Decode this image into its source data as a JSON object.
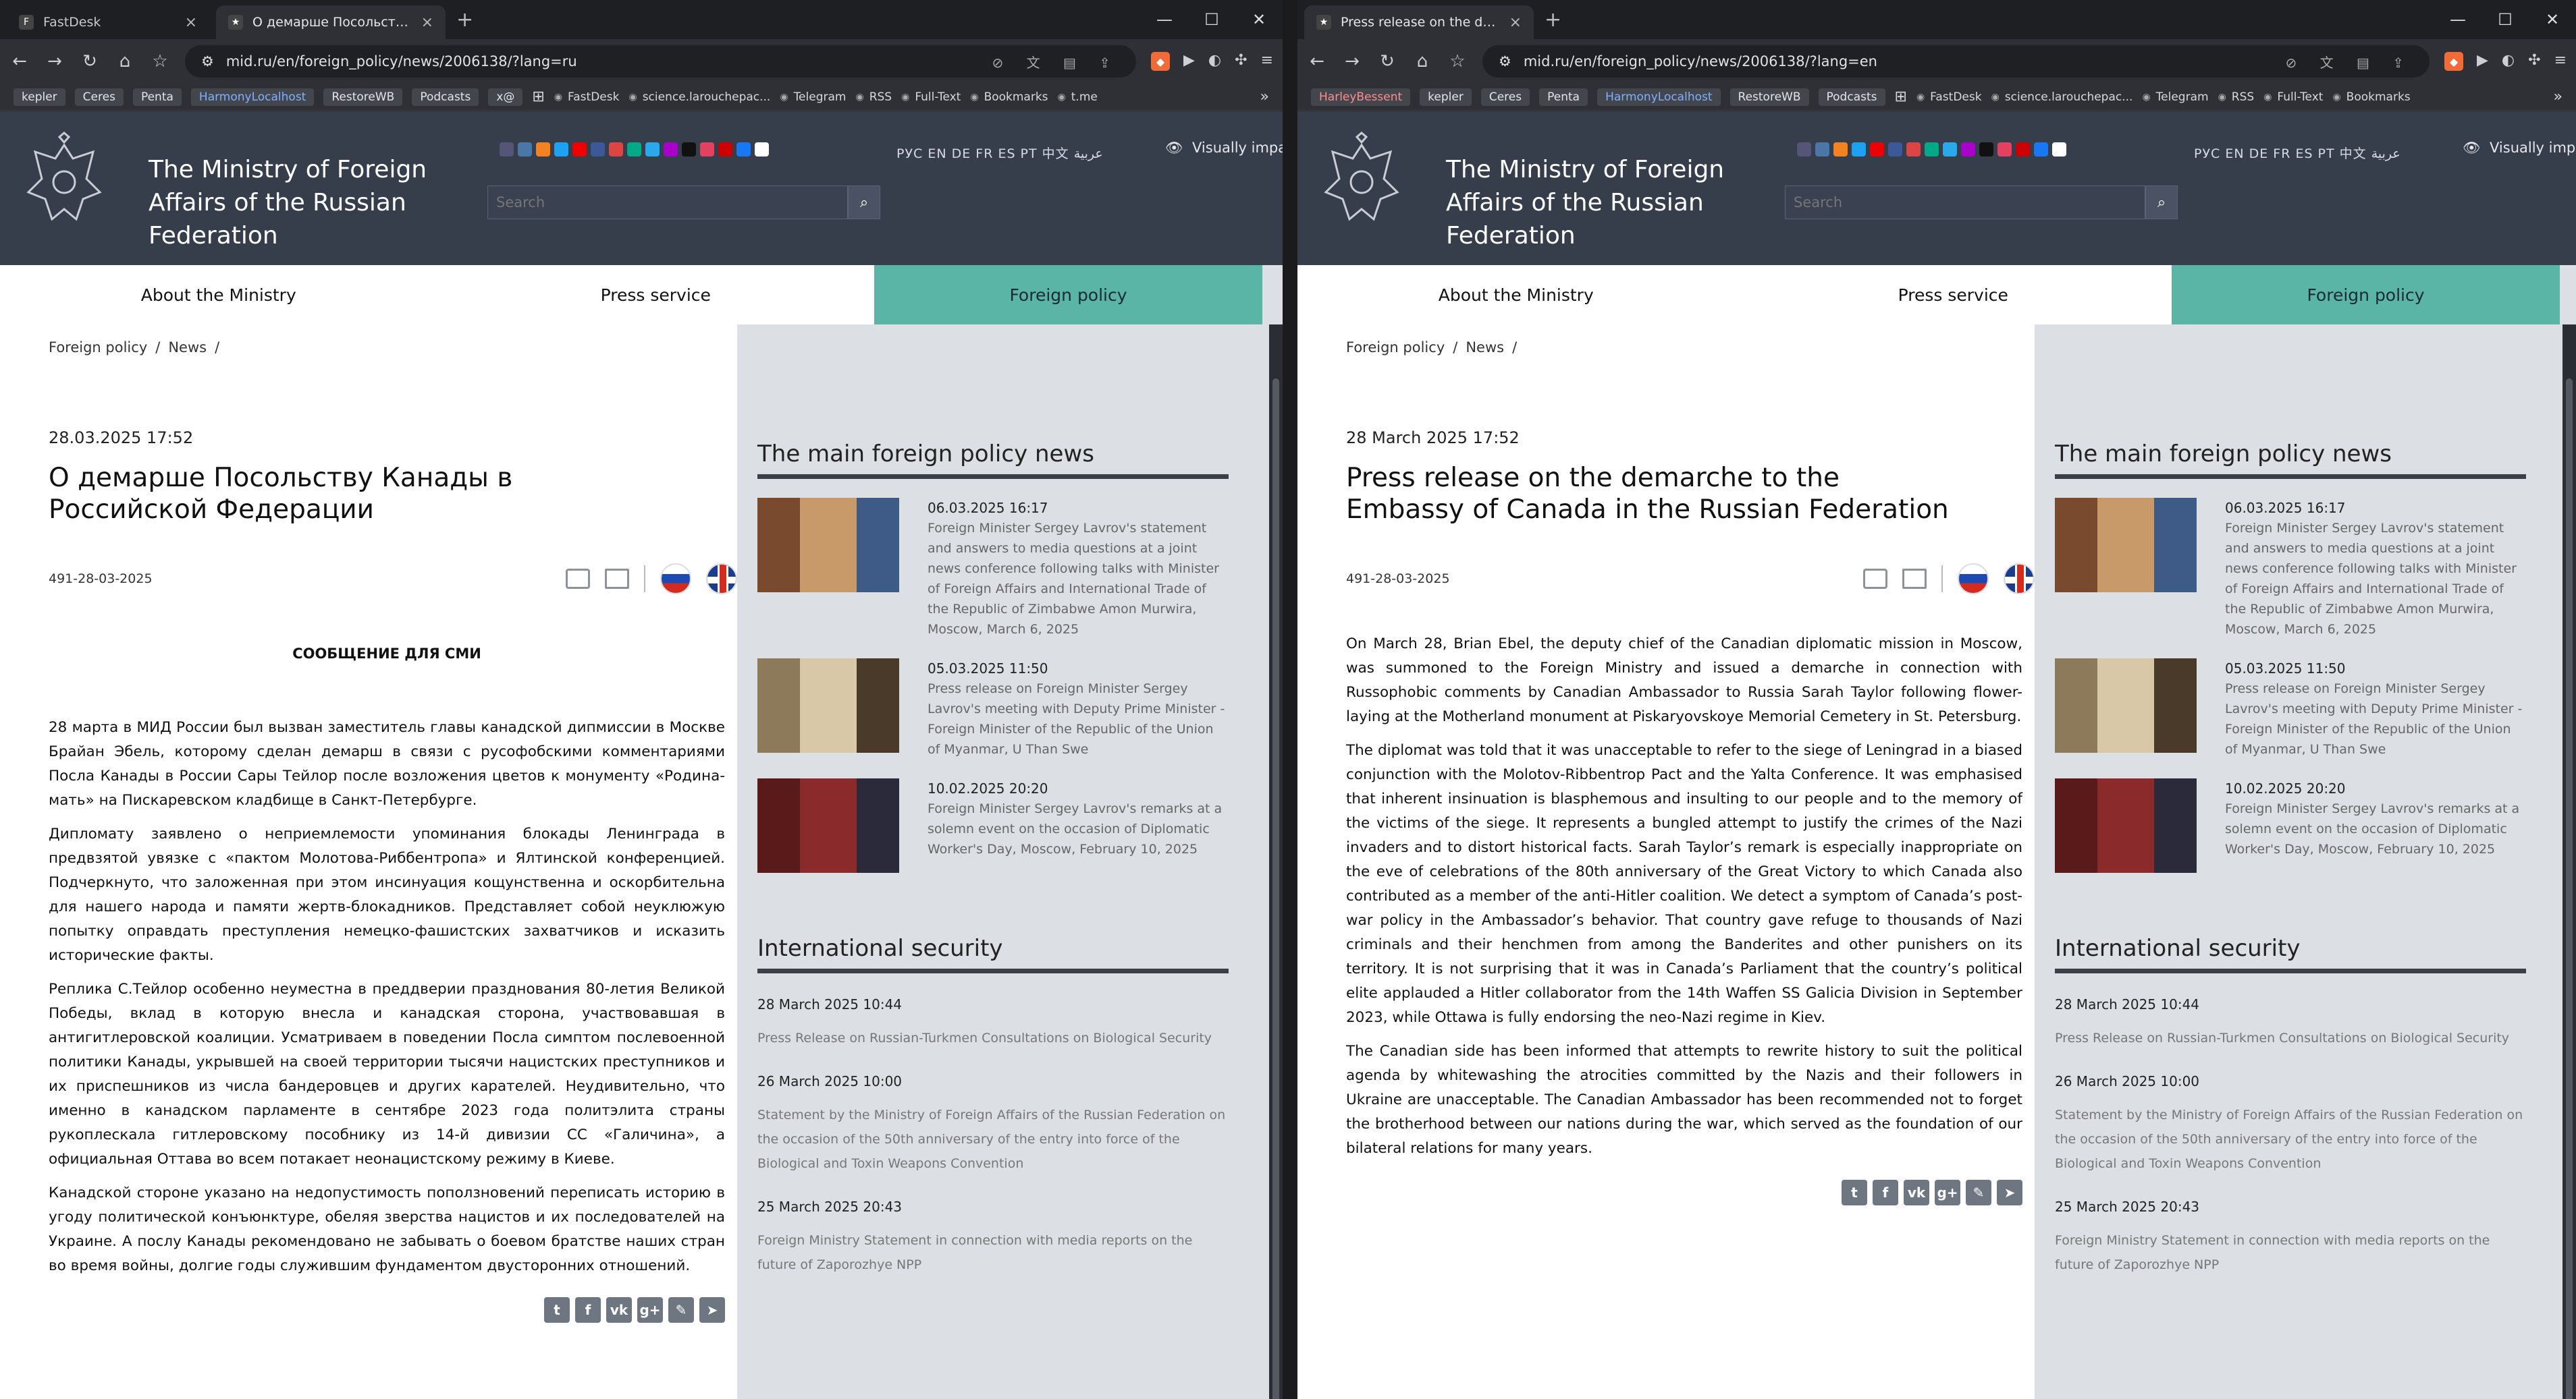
{
  "left": {
    "tabs": [
      {
        "label": "FastDesk",
        "icon": "F",
        "active": false
      },
      {
        "label": "О демарше Посольству Канад…",
        "icon": "★",
        "active": true
      }
    ],
    "url": "mid.ru/en/foreign_policy/news/2006138/?lang=ru",
    "bookmarks": {
      "chips": [
        "kepler",
        "Ceres",
        "Penta",
        "HarmonyLocalhost",
        "RestoreWB",
        "Podcasts",
        "x@"
      ],
      "links": [
        "FastDesk",
        "science.larouchepac...",
        "Telegram",
        "RSS",
        "Full-Text",
        "Bookmarks",
        "t.me"
      ]
    },
    "article": {
      "date": "28.03.2025 17:52",
      "title": "О демарше Посольству Канады в Российской Федерации",
      "number": "491-28-03-2025",
      "label": "СООБЩЕНИЕ ДЛЯ СМИ",
      "paragraphs": [
        "28 марта в МИД России был вызван заместитель главы канадской дипмиссии в Москве Брайан Эбель, которому сделан демарш в связи с русофобскими комментариями Посла Канады в России Сары Тейлор после возложения цветов к монументу «Родина-мать» на Пискаревском кладбище в Санкт-Петербурге.",
        "Дипломату заявлено о неприемлемости упоминания блокады Ленинграда в предвзятой увязке с «пактом Молотова-Риббентропа» и Ялтинской конференцией. Подчеркнуто, что заложенная при этом инсинуация кощунственна и оскорбительна для нашего народа и памяти жертв-блокадников. Представляет собой неуклюжую попытку оправдать преступления немецко-фашистских захватчиков и исказить исторические факты.",
        "Реплика С.Тейлор особенно неуместна в преддверии празднования 80-летия Великой Победы, вклад в которую внесла и канадская сторона, участвовавшая в антигитлеровской коалиции. Усматриваем в поведении Посла симптом послевоенной политики Канады, укрывшей на своей территории тысячи нацистских преступников и их приспешников из числа бандеровцев и других карателей. Неудивительно, что именно в канадском парламенте в сентябре 2023 года политэлита страны рукоплескала гитлеровскому пособнику из 14-й дивизии СС «Галичина», а официальная Оттава во всем потакает неонацистскому режиму в Киеве.",
        "Канадской стороне указано на недопустимость поползновений переписать историю в угоду политической конъюнктуре, обеляя зверства нацистов и их последователей на Украине. А послу Канады рекомендовано не забывать о боевом братстве наших стран во время войны, долгие годы служившим фундаментом двусторонних отношений."
      ]
    }
  },
  "right": {
    "tabs": [
      {
        "label": "Press release on the demarche",
        "icon": "★",
        "active": true
      }
    ],
    "url": "mid.ru/en/foreign_policy/news/2006138/?lang=en",
    "bookmarks": {
      "chips": [
        "HarleyBessent",
        "kepler",
        "Ceres",
        "Penta",
        "HarmonyLocalhost",
        "RestoreWB",
        "Podcasts"
      ],
      "links": [
        "FastDesk",
        "science.larouchepac...",
        "Telegram",
        "RSS",
        "Full-Text",
        "Bookmarks"
      ]
    },
    "article": {
      "date": "28 March 2025 17:52",
      "title": "Press release on the demarche to the Embassy of Canada in the Russian Federation",
      "number": "491-28-03-2025",
      "label": "",
      "paragraphs": [
        "On March 28, Brian Ebel, the deputy chief of the Canadian diplomatic mission in Moscow, was summoned to the Foreign Ministry and issued a demarche in connection with Russophobic comments by Canadian Ambassador to Russia Sarah Taylor following flower-laying at the Motherland monument at Piskaryovskoye Memorial Cemetery in St. Petersburg.",
        "The diplomat was told that it was unacceptable to refer to the siege of Leningrad   in a biased conjunction with the Molotov-Ribbentrop Pact and the Yalta Conference. It was emphasised that inherent insinuation is blasphemous and insulting to our people and to the memory of the victims of the siege. It represents a bungled attempt to justify the crimes of the Nazi invaders and to distort historical facts. Sarah Taylor’s remark is especially inappropriate on the eve of celebrations of the 80th anniversary of the Great Victory to which Canada also contributed as a member of the anti-Hitler coalition. We detect a symptom of Canada’s post-war policy in the Ambassador’s behavior. That country gave refuge to thousands of Nazi criminals and their henchmen from among the Banderites and other punishers on its territory. It is not surprising that it was in Canada’s Parliament that the country’s political elite applauded a Hitler collaborator from the 14th Waffen SS Galicia Division in September 2023, while Ottawa is fully endorsing the neo-Nazi regime in Kiev.",
        "The Canadian side has been informed that attempts to rewrite history to suit the political agenda by whitewashing the atrocities committed by the Nazis and their followers in Ukraine are unacceptable. The Canadian Ambassador has been recommended not to forget the brotherhood between our nations during the war, which served as the foundation of our bilateral relations for many years."
      ]
    }
  },
  "site": {
    "name": "The Ministry of Foreign Affairs of the Russian Federation",
    "search_placeholder": "Search",
    "langs": "РУС EN DE FR ES PT 中文 عربية",
    "visually": "Visually impa",
    "nav": [
      "About the Ministry",
      "Press service",
      "Foreign policy"
    ],
    "breadcrumbs": [
      "Foreign policy",
      "News"
    ],
    "main_news_heading": "The main foreign policy news",
    "main_news": [
      {
        "date": "06.03.2025 16:17",
        "text": "Foreign Minister Sergey Lavrov's statement and answers to media questions at a joint news conference following talks with Minister of Foreign Affairs and International Trade of the Republic of Zimbabwe Amon Murwira, Moscow, March 6, 2025"
      },
      {
        "date": "05.03.2025 11:50",
        "text": "Press release on Foreign Minister Sergey Lavrov's meeting with Deputy Prime Minister - Foreign Minister of the Republic of the Union of Myanmar, U Than Swe"
      },
      {
        "date": "10.02.2025 20:20",
        "text": "Foreign Minister Sergey Lavrov's remarks at a solemn event on the occasion of Diplomatic Worker's Day, Moscow, February 10, 2025"
      }
    ],
    "security_heading": "International security",
    "security": [
      {
        "date": "28 March 2025 10:44",
        "text": "Press Release on Russian-Turkmen Consultations on Biological Security"
      },
      {
        "date": "26 March 2025 10:00",
        "text": "Statement by the Ministry of Foreign Affairs of the Russian Federation on the occasion of the 50th anniversary of the entry into force of the Biological and Toxin Weapons Convention"
      },
      {
        "date": "25 March 2025 20:43",
        "text": "Foreign Ministry Statement in connection with media reports on the future of Zaporozhye NPP"
      }
    ]
  },
  "colors": {
    "header": "#363d4b",
    "nav_active": "#5ab5a7",
    "page_bg": "#dcdfe4"
  }
}
